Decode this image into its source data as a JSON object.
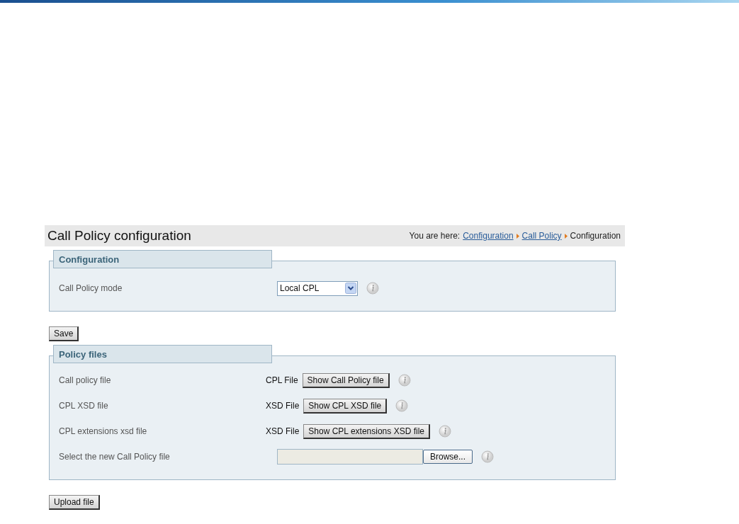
{
  "page": {
    "title": "Call Policy configuration",
    "breadcrumb": {
      "prefix": "You are here:",
      "links": [
        "Configuration",
        "Call Policy"
      ],
      "current": "Configuration"
    }
  },
  "sections": [
    {
      "legend": "Configuration",
      "button": "Save",
      "rows": [
        {
          "kind": "select",
          "label": "Call Policy mode",
          "value": "Local CPL"
        }
      ]
    },
    {
      "legend": "Policy files",
      "button": "Upload file",
      "rows": [
        {
          "kind": "show",
          "label": "Call policy file",
          "prefix": "CPL File",
          "button": "Show Call Policy file"
        },
        {
          "kind": "show",
          "label": "CPL XSD file",
          "prefix": "XSD File",
          "button": "Show CPL XSD file"
        },
        {
          "kind": "show",
          "label": "CPL extensions xsd file",
          "prefix": "XSD File",
          "button": "Show CPL extensions XSD file"
        },
        {
          "kind": "upload",
          "label": "Select the new Call Policy file",
          "button": "Browse..."
        }
      ]
    }
  ]
}
